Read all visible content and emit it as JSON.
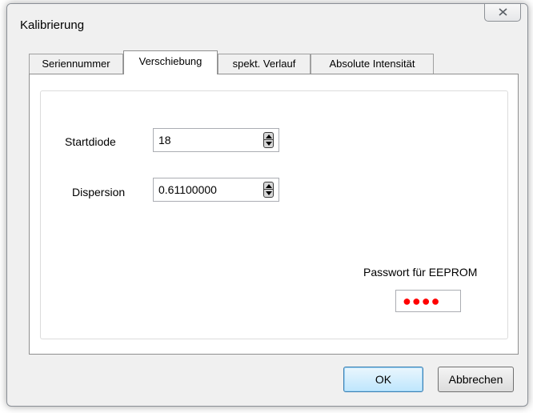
{
  "window": {
    "title": "Kalibrierung"
  },
  "tabs": [
    {
      "label": "Seriennummer",
      "active": false
    },
    {
      "label": "Verschiebung",
      "active": true
    },
    {
      "label": "spekt. Verlauf",
      "active": false
    },
    {
      "label": "Absolute Intensität",
      "active": false
    }
  ],
  "form": {
    "startdiode_label": "Startdiode",
    "startdiode_value": "18",
    "dispersion_label": "Dispersion",
    "dispersion_value": "0.61100000",
    "password_label": "Passwort für EEPROM",
    "password_mask": "●●●●"
  },
  "buttons": {
    "ok": "OK",
    "cancel": "Abbrechen"
  },
  "colors": {
    "password_mask": "#ff0000",
    "default_button_border": "#3c7fb1"
  },
  "icons": {
    "close": "close-icon",
    "spin": "spin-arrows-icon"
  }
}
